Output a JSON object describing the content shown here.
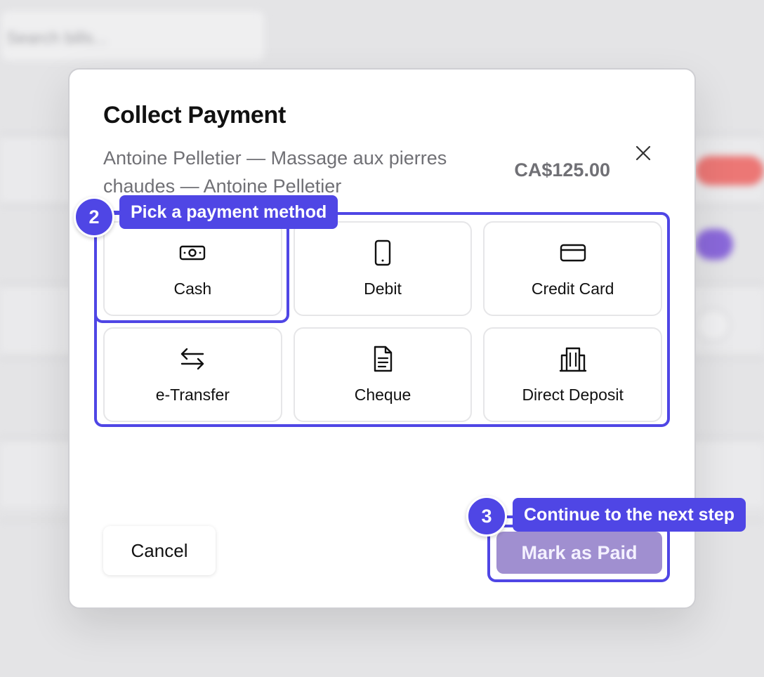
{
  "background": {
    "search_placeholder": "Search bills..."
  },
  "modal": {
    "title": "Collect Payment",
    "subtitle": "Antoine Pelletier — Massage aux pierres chaudes — Antoine Pelletier",
    "amount": "CA$125.00",
    "close_icon": "close-icon",
    "methods": [
      {
        "label": "Cash",
        "icon": "cash-icon"
      },
      {
        "label": "Debit",
        "icon": "phone-icon"
      },
      {
        "label": "Credit Card",
        "icon": "credit-card-icon"
      },
      {
        "label": "e-Transfer",
        "icon": "transfer-arrows-icon"
      },
      {
        "label": "Cheque",
        "icon": "document-icon"
      },
      {
        "label": "Direct Deposit",
        "icon": "bank-building-icon"
      }
    ],
    "cancel_label": "Cancel",
    "mark_paid_label": "Mark as Paid"
  },
  "steps": [
    {
      "number": "2",
      "text": "Pick a payment method"
    },
    {
      "number": "3",
      "text": "Continue to the next step"
    }
  ],
  "colors": {
    "accent": "#4f46e5",
    "paid_button": "#a08fd0"
  }
}
